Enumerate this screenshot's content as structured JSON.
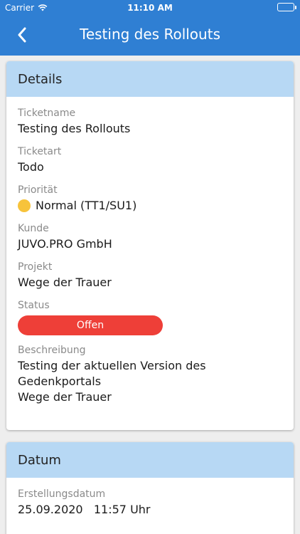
{
  "statusbar": {
    "carrier": "Carrier",
    "time": "11:10 AM"
  },
  "nav": {
    "title": "Testing des Rollouts"
  },
  "details": {
    "heading": "Details",
    "ticketname": {
      "label": "Ticketname",
      "value": "Testing des Rollouts"
    },
    "ticketart": {
      "label": "Ticketart",
      "value": "Todo"
    },
    "prioritaet": {
      "label": "Priorität",
      "value": "Normal (TT1/SU1)",
      "color": "#f7c33b"
    },
    "kunde": {
      "label": "Kunde",
      "value": "JUVO.PRO GmbH"
    },
    "projekt": {
      "label": "Projekt",
      "value": "Wege der Trauer"
    },
    "status": {
      "label": "Status",
      "value": "Offen",
      "color": "#ee3f38"
    },
    "beschreibung": {
      "label": "Beschreibung",
      "line1": "Testing der aktuellen Version des Gedenkportals",
      "line2": "Wege der Trauer"
    }
  },
  "datum": {
    "heading": "Datum",
    "erstellungsdatum": {
      "label": "Erstellungsdatum",
      "value": "25.09.2020   11:57 Uhr"
    }
  },
  "colors": {
    "primary": "#2f7fd3",
    "section_header": "#b7d8f4",
    "background": "#eeeeee"
  }
}
